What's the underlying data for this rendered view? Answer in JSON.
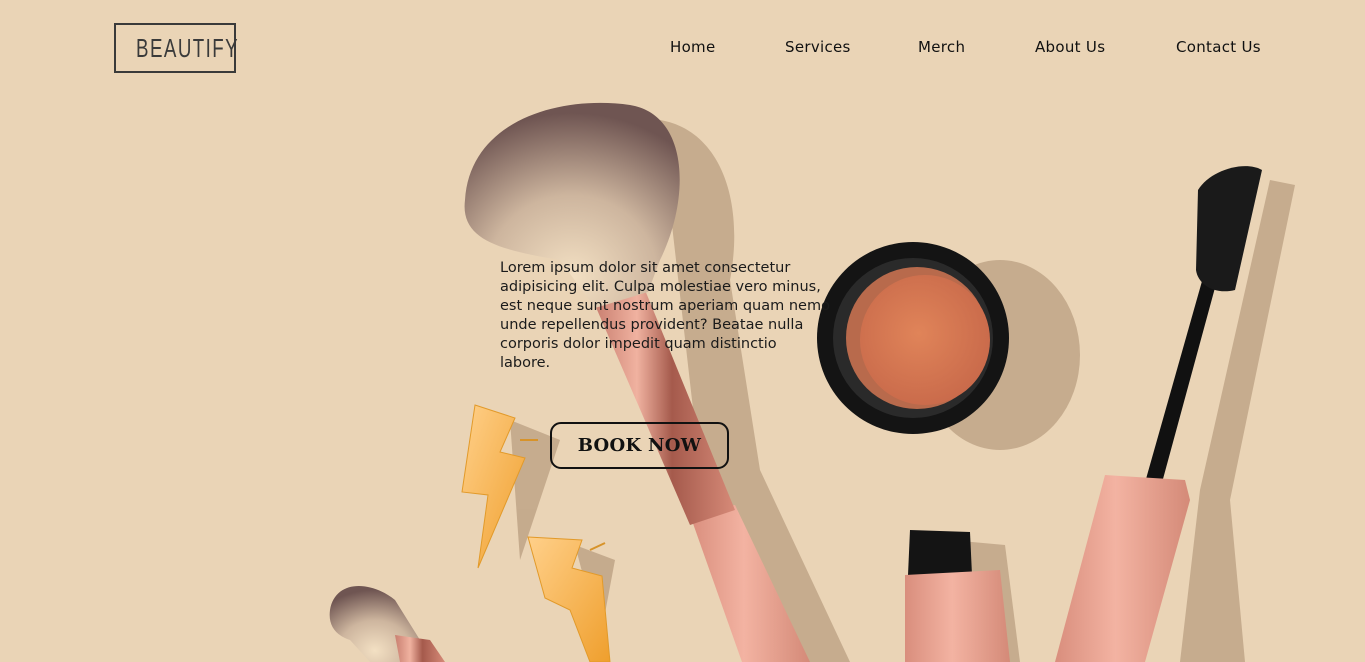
{
  "brand": {
    "logo_text": "BEAUTIFY"
  },
  "nav": {
    "items": [
      {
        "label": "Home"
      },
      {
        "label": "Services"
      },
      {
        "label": "Merch"
      },
      {
        "label": "About Us"
      },
      {
        "label": "Contact Us"
      }
    ]
  },
  "hero": {
    "description": "Lorem ipsum dolor sit amet consectetur adipisicing elit. Culpa molestiae vero minus, est neque sunt nostrum aperiam quam nemo unde repellendus provident? Beatae nulla corporis dolor impedit quam distinctio labore.",
    "cta_label": "BOOK NOW"
  },
  "colors": {
    "background": "#ead4b6",
    "text": "#111111",
    "accent_pink": "#e9a594",
    "accent_gold": "#f2a93b"
  },
  "icons": [
    "makeup-brush-icon",
    "blush-compact-icon",
    "mascara-icon",
    "lightning-earring-icon"
  ]
}
